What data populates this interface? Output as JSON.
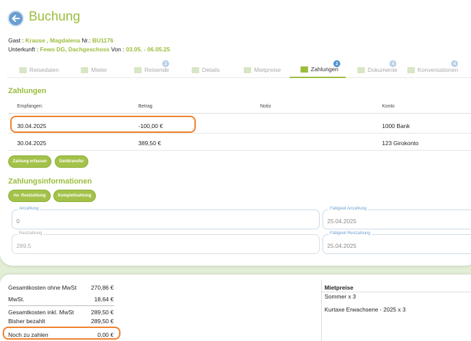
{
  "header": {
    "title": "Buchung",
    "guest_label": "Gast : ",
    "guest_name": "Krause , Magdalena",
    "nr_label": " Nr.: ",
    "nr_value": "BU1176",
    "unterkunft_label": "Unterkunft : ",
    "unterkunft_value": "Fewo DG, Dachgeschoss",
    "von_label": " Von : ",
    "von_value": "03.05. - 06.05.25"
  },
  "tabs": [
    {
      "label": "Reisedaten",
      "badge": ""
    },
    {
      "label": "Mieter",
      "badge": ""
    },
    {
      "label": "Reisende",
      "badge": "2"
    },
    {
      "label": "Details",
      "badge": ""
    },
    {
      "label": "Mietpreise",
      "badge": ""
    },
    {
      "label": "Zahlungen",
      "badge": "2"
    },
    {
      "label": "Dokumente",
      "badge": "4"
    },
    {
      "label": "Konversationen",
      "badge": "4"
    }
  ],
  "payments": {
    "title": "Zahlungen",
    "columns": [
      "Empfangen:",
      "Betrag",
      "Notiz",
      "Konto"
    ],
    "rows": [
      {
        "date": "30.04.2025",
        "amount": "-100,00 €",
        "note": "",
        "account": "1000 Bank"
      },
      {
        "date": "30.04.2025",
        "amount": "389,50 €",
        "note": "",
        "account": "123 Girokonto"
      }
    ],
    "buttons": {
      "add": "Zahlung erfassen",
      "transfer": "Geldtransfer"
    }
  },
  "payment_info": {
    "title": "Zahlungsinformationen",
    "buttons": {
      "partial": "An- Restzahlung",
      "full": "Komplettzahlung"
    },
    "anzahlung_label": "Anzahlung",
    "anzahlung_value": "0",
    "faellig_anzahlung_label": "Fälligkeit Anzahlung",
    "faellig_anzahlung_value": "25.04.2025",
    "restzahlung_label": "Restzahlung",
    "restzahlung_value": "289,5",
    "faellig_rest_label": "Fälligkeit Restzahlung",
    "faellig_rest_value": "25.04.2025"
  },
  "summary": {
    "netto_label": "Gesamtkosten ohne MwSt",
    "netto_value": "270,86 €",
    "mwst_label": "MwSt.",
    "mwst_value": "18,64 €",
    "brutto_label": "Gesamtkosten inkl. MwSt",
    "brutto_value": "289,50 €",
    "bezahlt_label": "Bisher bezahlt",
    "bezahlt_value": "289,50 €",
    "offen_label": "Noch zu zahlen",
    "offen_value": "0,00 €"
  },
  "mietpreise": {
    "title": "Mietpreise",
    "line1": "Sommer x 3",
    "line2": "Kurtaxe Erwachsene - 2025 x 3"
  },
  "colors": {
    "accent_green": "#9bbd3c",
    "highlight_orange": "#ef7f2a",
    "blue": "#6b9fd1"
  }
}
